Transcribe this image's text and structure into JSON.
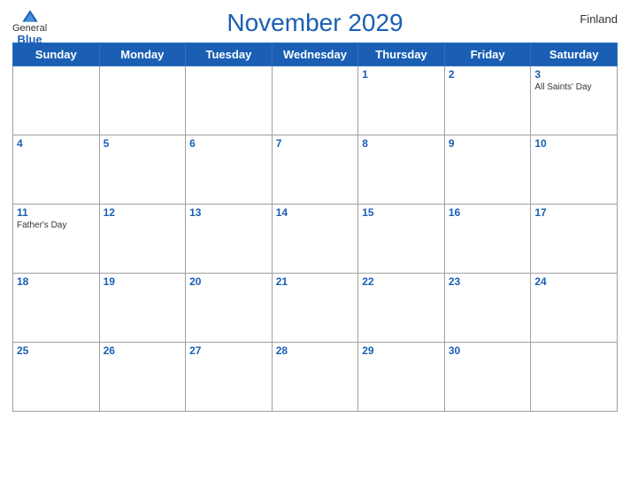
{
  "header": {
    "title": "November 2029",
    "country": "Finland",
    "logo": {
      "general": "General",
      "blue": "Blue"
    }
  },
  "days_of_week": [
    "Sunday",
    "Monday",
    "Tuesday",
    "Wednesday",
    "Thursday",
    "Friday",
    "Saturday"
  ],
  "weeks": [
    [
      {
        "day": "",
        "holiday": ""
      },
      {
        "day": "",
        "holiday": ""
      },
      {
        "day": "",
        "holiday": ""
      },
      {
        "day": "",
        "holiday": ""
      },
      {
        "day": "1",
        "holiday": ""
      },
      {
        "day": "2",
        "holiday": ""
      },
      {
        "day": "3",
        "holiday": "All Saints' Day"
      }
    ],
    [
      {
        "day": "4",
        "holiday": ""
      },
      {
        "day": "5",
        "holiday": ""
      },
      {
        "day": "6",
        "holiday": ""
      },
      {
        "day": "7",
        "holiday": ""
      },
      {
        "day": "8",
        "holiday": ""
      },
      {
        "day": "9",
        "holiday": ""
      },
      {
        "day": "10",
        "holiday": ""
      }
    ],
    [
      {
        "day": "11",
        "holiday": "Father's Day"
      },
      {
        "day": "12",
        "holiday": ""
      },
      {
        "day": "13",
        "holiday": ""
      },
      {
        "day": "14",
        "holiday": ""
      },
      {
        "day": "15",
        "holiday": ""
      },
      {
        "day": "16",
        "holiday": ""
      },
      {
        "day": "17",
        "holiday": ""
      }
    ],
    [
      {
        "day": "18",
        "holiday": ""
      },
      {
        "day": "19",
        "holiday": ""
      },
      {
        "day": "20",
        "holiday": ""
      },
      {
        "day": "21",
        "holiday": ""
      },
      {
        "day": "22",
        "holiday": ""
      },
      {
        "day": "23",
        "holiday": ""
      },
      {
        "day": "24",
        "holiday": ""
      }
    ],
    [
      {
        "day": "25",
        "holiday": ""
      },
      {
        "day": "26",
        "holiday": ""
      },
      {
        "day": "27",
        "holiday": ""
      },
      {
        "day": "28",
        "holiday": ""
      },
      {
        "day": "29",
        "holiday": ""
      },
      {
        "day": "30",
        "holiday": ""
      },
      {
        "day": "",
        "holiday": ""
      }
    ]
  ]
}
